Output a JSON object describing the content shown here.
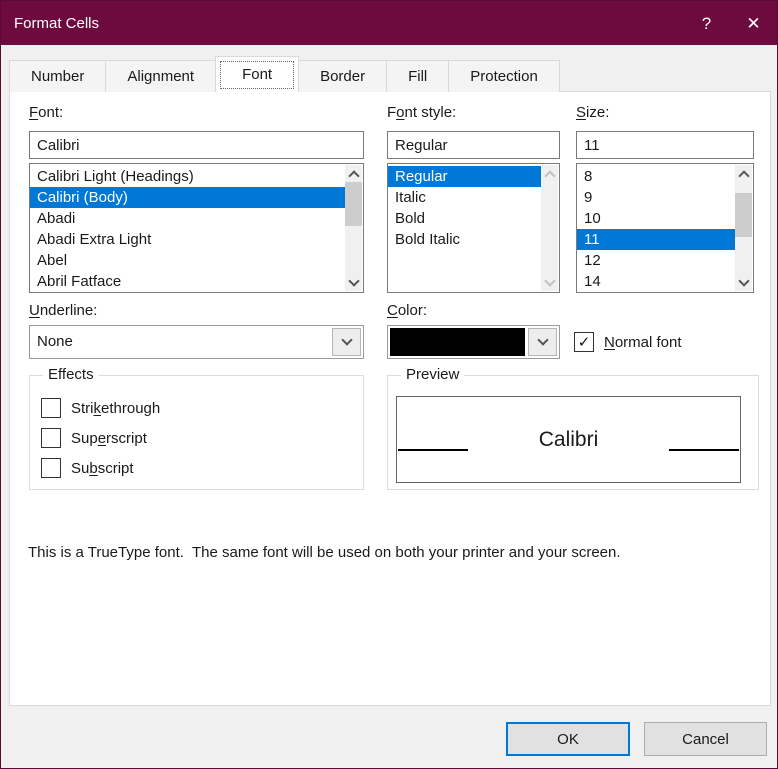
{
  "window": {
    "title": "Format Cells"
  },
  "icons": {
    "help": "?",
    "close": "✕",
    "check": "✓"
  },
  "colors": {
    "titlebar_accent": "#6E0B3E",
    "selection_blue": "#0078D7",
    "ok_border": "#0078D7",
    "color_swatch": "#000000"
  },
  "tabs": {
    "items": [
      "Number",
      "Alignment",
      "Font",
      "Border",
      "Fill",
      "Protection"
    ],
    "selected": "Font"
  },
  "font": {
    "label": {
      "pre": "",
      "key": "F",
      "post": "ont:"
    },
    "value": "Calibri",
    "items": [
      "Calibri Light (Headings)",
      "Calibri (Body)",
      "Abadi",
      "Abadi Extra Light",
      "Abel",
      "Abril Fatface"
    ],
    "selected": "Calibri (Body)"
  },
  "font_style": {
    "label": {
      "pre": "F",
      "key": "o",
      "post": "nt style:"
    },
    "value": "Regular",
    "items": [
      "Regular",
      "Italic",
      "Bold",
      "Bold Italic"
    ],
    "selected": "Regular"
  },
  "size": {
    "label": {
      "pre": "",
      "key": "S",
      "post": "ize:"
    },
    "value": "11",
    "items": [
      "8",
      "9",
      "10",
      "11",
      "12",
      "14"
    ],
    "selected": "11"
  },
  "underline": {
    "label": {
      "pre": "",
      "key": "U",
      "post": "nderline:"
    },
    "value": "None"
  },
  "color": {
    "label": {
      "pre": "",
      "key": "C",
      "post": "olor:"
    },
    "value_swatch": "#000000"
  },
  "normal_font": {
    "label": {
      "pre": "",
      "key": "N",
      "post": "ormal font"
    },
    "checked": true
  },
  "effects": {
    "legend": "Effects",
    "options": [
      {
        "pre": "Stri",
        "key": "k",
        "post": "ethrough",
        "checked": false
      },
      {
        "pre": "Sup",
        "key": "e",
        "post": "rscript",
        "checked": false
      },
      {
        "pre": "Su",
        "key": "b",
        "post": "script",
        "checked": false
      }
    ]
  },
  "preview": {
    "legend": "Preview",
    "sample_text": "Calibri"
  },
  "footer_note": "This is a TrueType font.  The same font will be used on both your printer and your screen.",
  "buttons": {
    "ok": "OK",
    "cancel": "Cancel"
  }
}
